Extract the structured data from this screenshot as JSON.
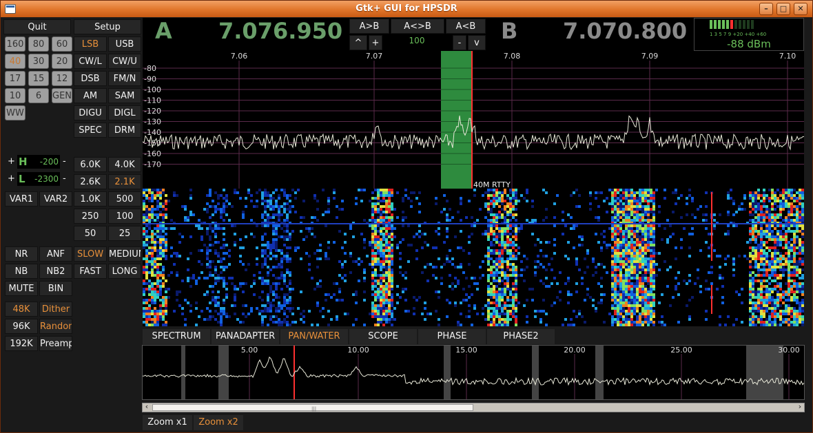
{
  "window": {
    "title": "Gtk+ GUI for HPSDR"
  },
  "left": {
    "quit": "Quit",
    "setup": "Setup",
    "bands": [
      "160",
      "80",
      "60",
      "40",
      "30",
      "20",
      "17",
      "15",
      "12",
      "10",
      "6",
      "GEN",
      "WW"
    ],
    "selected_band": "40",
    "modes": [
      "LSB",
      "USB",
      "CW/L",
      "CW/U",
      "DSB",
      "FM/N",
      "AM",
      "SAM",
      "DIGU",
      "DIGL",
      "SPEC",
      "DRM"
    ],
    "selected_mode": "LSB",
    "filter_high": {
      "plus": "+",
      "letter": "H",
      "value": "-200",
      "minus": "-"
    },
    "filter_low": {
      "plus": "+",
      "letter": "L",
      "value": "-2300",
      "minus": "-"
    },
    "var1": "VAR1",
    "var2": "VAR2",
    "filters": [
      "6.0K",
      "4.0K",
      "2.6K",
      "2.1K",
      "1.0K",
      "500",
      "250",
      "100",
      "50",
      "25"
    ],
    "selected_filter": "2.1K",
    "dsp": [
      "NR",
      "ANF",
      "NB",
      "NB2",
      "MUTE",
      "BIN"
    ],
    "agc": [
      "SLOW",
      "MEDIUM",
      "FAST",
      "LONG"
    ],
    "selected_agc": "SLOW",
    "rates": [
      "48K",
      "96K",
      "192K"
    ],
    "selected_rate": "48K",
    "options": [
      "Dither",
      "Random",
      "Preamp"
    ]
  },
  "vfo": {
    "a_letter": "A",
    "a_freq": "7.076.950",
    "b_letter": "B",
    "b_freq": "7.070.800",
    "a_to_b": "A>B",
    "swap": "A<>B",
    "b_to_a": "A<B",
    "up": "^",
    "plus": "+",
    "step": "100",
    "minus": "-",
    "down": "v"
  },
  "meter": {
    "scale": "1  3  5  7  9  +20 +40 +60",
    "reading": "-88 dBm",
    "level_segments": 5
  },
  "panadapter": {
    "freq_labels": [
      "7.06",
      "7.07",
      "7.08",
      "7.09",
      "7.10"
    ],
    "db_labels": [
      "-80",
      "-90",
      "-100",
      "-110",
      "-120",
      "-130",
      "-140",
      "-150",
      "-160",
      "-170"
    ],
    "marker": "40M RTTY",
    "colors": {
      "grid": "#5a2a4a",
      "filter": "#2e8b3e",
      "cursor": "#ff3030",
      "trace": "#e8e8d8"
    }
  },
  "tabs": [
    "SPECTRUM",
    "PANADAPTER",
    "PAN/WATER",
    "SCOPE",
    "PHASE",
    "PHASE2"
  ],
  "selected_tab": "PAN/WATER",
  "bandscope": {
    "freq_labels": [
      "5.00",
      "10.00",
      "15.00",
      "20.00",
      "25.00",
      "30.00"
    ]
  },
  "zoom": {
    "x1": "Zoom x1",
    "x2": "Zoom x2",
    "selected": "Zoom x2"
  }
}
